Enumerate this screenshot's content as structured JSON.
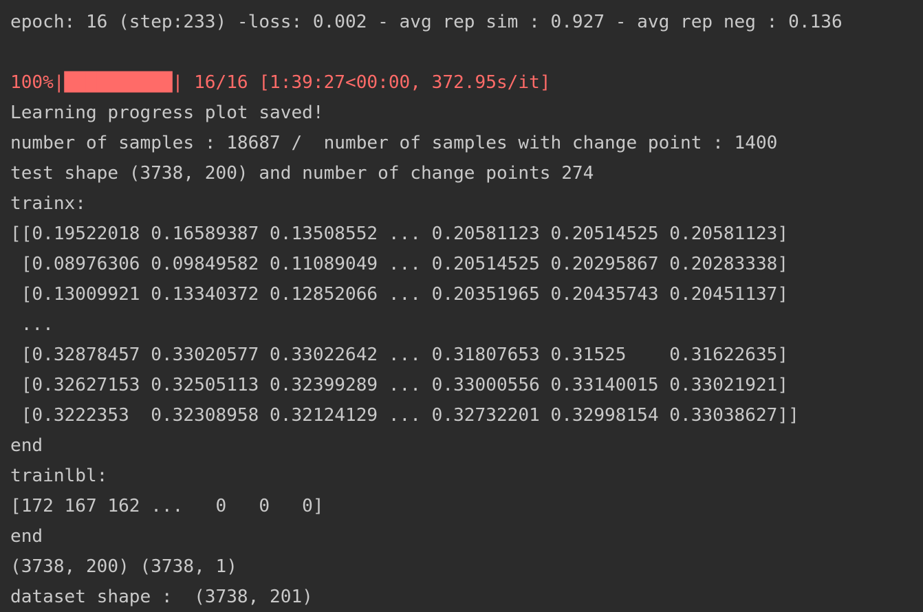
{
  "console": {
    "lines": [
      {
        "text": "epoch: 16 (step:233) -loss: 0.002 - avg rep sim : 0.927 - avg rep neg : 0.136",
        "kind": "normal"
      },
      {
        "text": "",
        "kind": "blank"
      },
      {
        "text": "100%|██████████| 16/16 [1:39:27<00:00, 372.95s/it]",
        "kind": "err"
      },
      {
        "text": "Learning progress plot saved!",
        "kind": "normal"
      },
      {
        "text": "number of samples : 18687 /  number of samples with change point : 1400",
        "kind": "normal"
      },
      {
        "text": "test shape (3738, 200) and number of change points 274",
        "kind": "normal"
      },
      {
        "text": "trainx:",
        "kind": "normal"
      },
      {
        "text": "[[0.19522018 0.16589387 0.13508552 ... 0.20581123 0.20514525 0.20581123]",
        "kind": "normal"
      },
      {
        "text": " [0.08976306 0.09849582 0.11089049 ... 0.20514525 0.20295867 0.20283338]",
        "kind": "normal"
      },
      {
        "text": " [0.13009921 0.13340372 0.12852066 ... 0.20351965 0.20435743 0.20451137]",
        "kind": "normal"
      },
      {
        "text": " ...",
        "kind": "normal"
      },
      {
        "text": " [0.32878457 0.33020577 0.33022642 ... 0.31807653 0.31525    0.31622635]",
        "kind": "normal"
      },
      {
        "text": " [0.32627153 0.32505113 0.32399289 ... 0.33000556 0.33140015 0.33021921]",
        "kind": "normal"
      },
      {
        "text": " [0.3222353  0.32308958 0.32124129 ... 0.32732201 0.32998154 0.33038627]]",
        "kind": "normal"
      },
      {
        "text": "end",
        "kind": "normal"
      },
      {
        "text": "trainlbl:",
        "kind": "normal"
      },
      {
        "text": "[172 167 162 ...   0   0   0]",
        "kind": "normal"
      },
      {
        "text": "end",
        "kind": "normal"
      },
      {
        "text": "(3738, 200) (3738, 1)",
        "kind": "normal"
      },
      {
        "text": "dataset shape :  (3738, 201)",
        "kind": "normal"
      }
    ]
  },
  "colors": {
    "background": "#2b2b2b",
    "text": "#c9c9c9",
    "stderr": "#ff6b68"
  }
}
